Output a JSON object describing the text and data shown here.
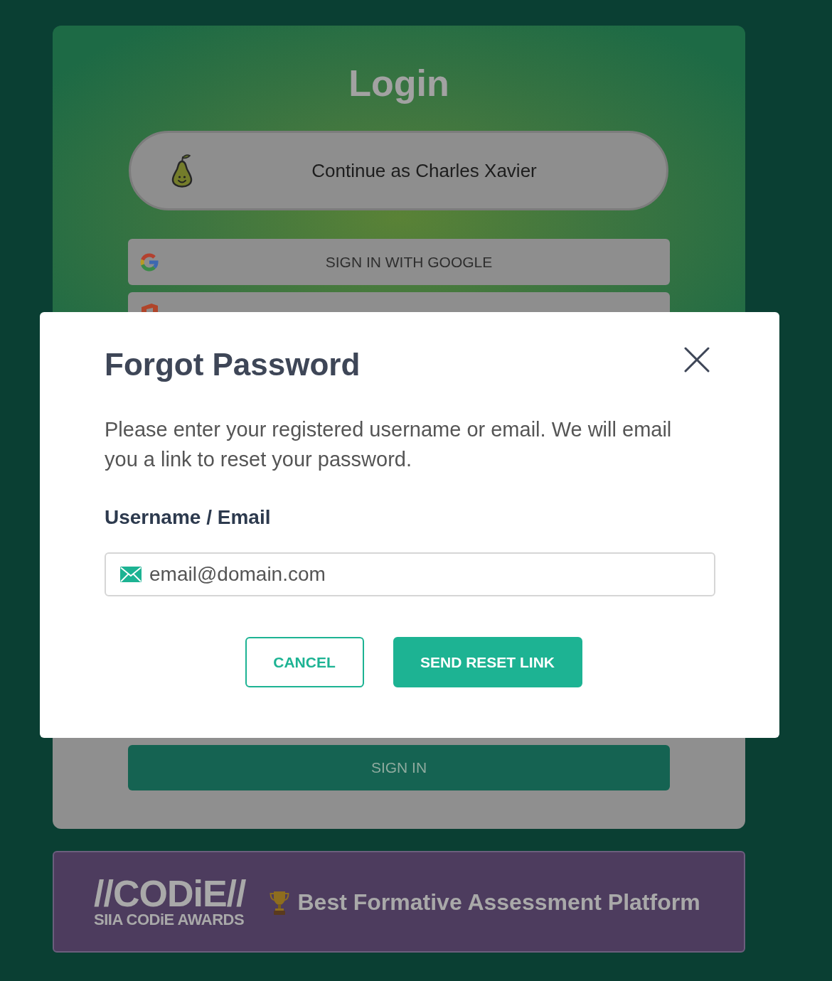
{
  "login_card": {
    "title": "Login",
    "continue_button": {
      "label": "Continue as Charles Xavier"
    },
    "sign_in_options": [
      {
        "kind": "google",
        "label": "SIGN IN WITH GOOGLE"
      },
      {
        "kind": "office"
      }
    ],
    "sign_in_button": {
      "label": "SIGN IN"
    }
  },
  "award_banner": {
    "logo_title": "//CODiE//",
    "logo_subtitle": "SIIA CODiE AWARDS",
    "text": "Best Formative Assessment Platform"
  },
  "dialog": {
    "title": "Forgot Password",
    "description": "Please enter your registered username or email. We will email you a link to reset your password.",
    "field": {
      "label": "Username / Email",
      "placeholder": "email@domain.com"
    },
    "buttons": [
      {
        "kind": "secondary",
        "label": "CANCEL"
      },
      {
        "kind": "primary",
        "label": "SEND RESET LINK"
      }
    ]
  }
}
